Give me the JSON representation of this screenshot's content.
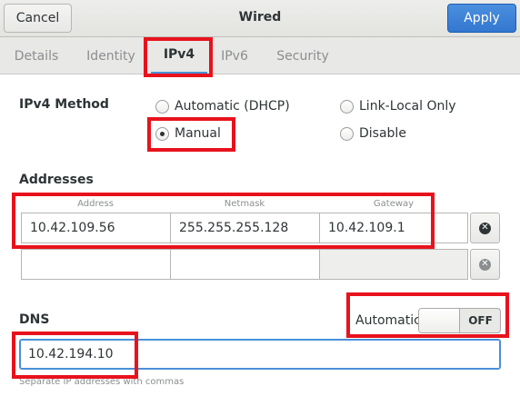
{
  "header": {
    "cancel_label": "Cancel",
    "title": "Wired",
    "apply_label": "Apply"
  },
  "tabs": [
    {
      "label": "Details"
    },
    {
      "label": "Identity"
    },
    {
      "label": "IPv4",
      "active": true
    },
    {
      "label": "IPv6"
    },
    {
      "label": "Security"
    }
  ],
  "ipv4_method": {
    "label": "IPv4 Method",
    "options": [
      {
        "label": "Automatic (DHCP)",
        "checked": false
      },
      {
        "label": "Link-Local Only",
        "checked": false
      },
      {
        "label": "Manual",
        "checked": true
      },
      {
        "label": "Disable",
        "checked": false
      }
    ]
  },
  "addresses": {
    "section_label": "Addresses",
    "columns": [
      "Address",
      "Netmask",
      "Gateway"
    ],
    "rows": [
      {
        "address": "10.42.109.56",
        "netmask": "255.255.255.128",
        "gateway": "10.42.109.1"
      },
      {
        "address": "",
        "netmask": "",
        "gateway": ""
      }
    ]
  },
  "dns": {
    "label": "DNS",
    "automatic_label": "Automatic",
    "switch_state": "OFF",
    "value": "10.42.194.10",
    "hint": "Separate IP addresses with commas"
  },
  "colors": {
    "accent": "#4a90d9",
    "apply_button": "#3377d0",
    "annotation": "#e8121c",
    "delete_active": "#2e3436",
    "delete_inactive": "#8b8e8f"
  },
  "icons": {
    "delete_row": "remove-circle-icon"
  }
}
